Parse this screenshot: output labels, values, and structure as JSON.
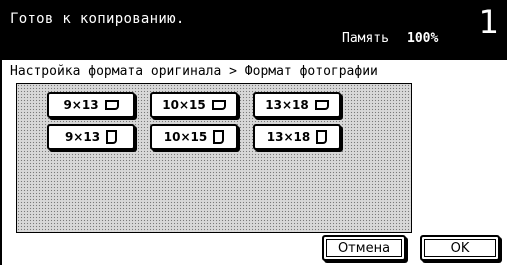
{
  "status": {
    "message": "Готов к копированию.",
    "memory_label": "Память",
    "memory_value": "100%",
    "copy_count": "1"
  },
  "breadcrumb": "Настройка формата оригинала > Формат фотографии",
  "formats": [
    {
      "label": "9×13",
      "orientation": "landscape"
    },
    {
      "label": "10×15",
      "orientation": "landscape"
    },
    {
      "label": "13×18",
      "orientation": "landscape"
    },
    {
      "label": "9×13",
      "orientation": "portrait"
    },
    {
      "label": "10×15",
      "orientation": "portrait"
    },
    {
      "label": "13×18",
      "orientation": "portrait"
    }
  ],
  "actions": {
    "cancel_label": "Отмена",
    "ok_label": "OK"
  }
}
